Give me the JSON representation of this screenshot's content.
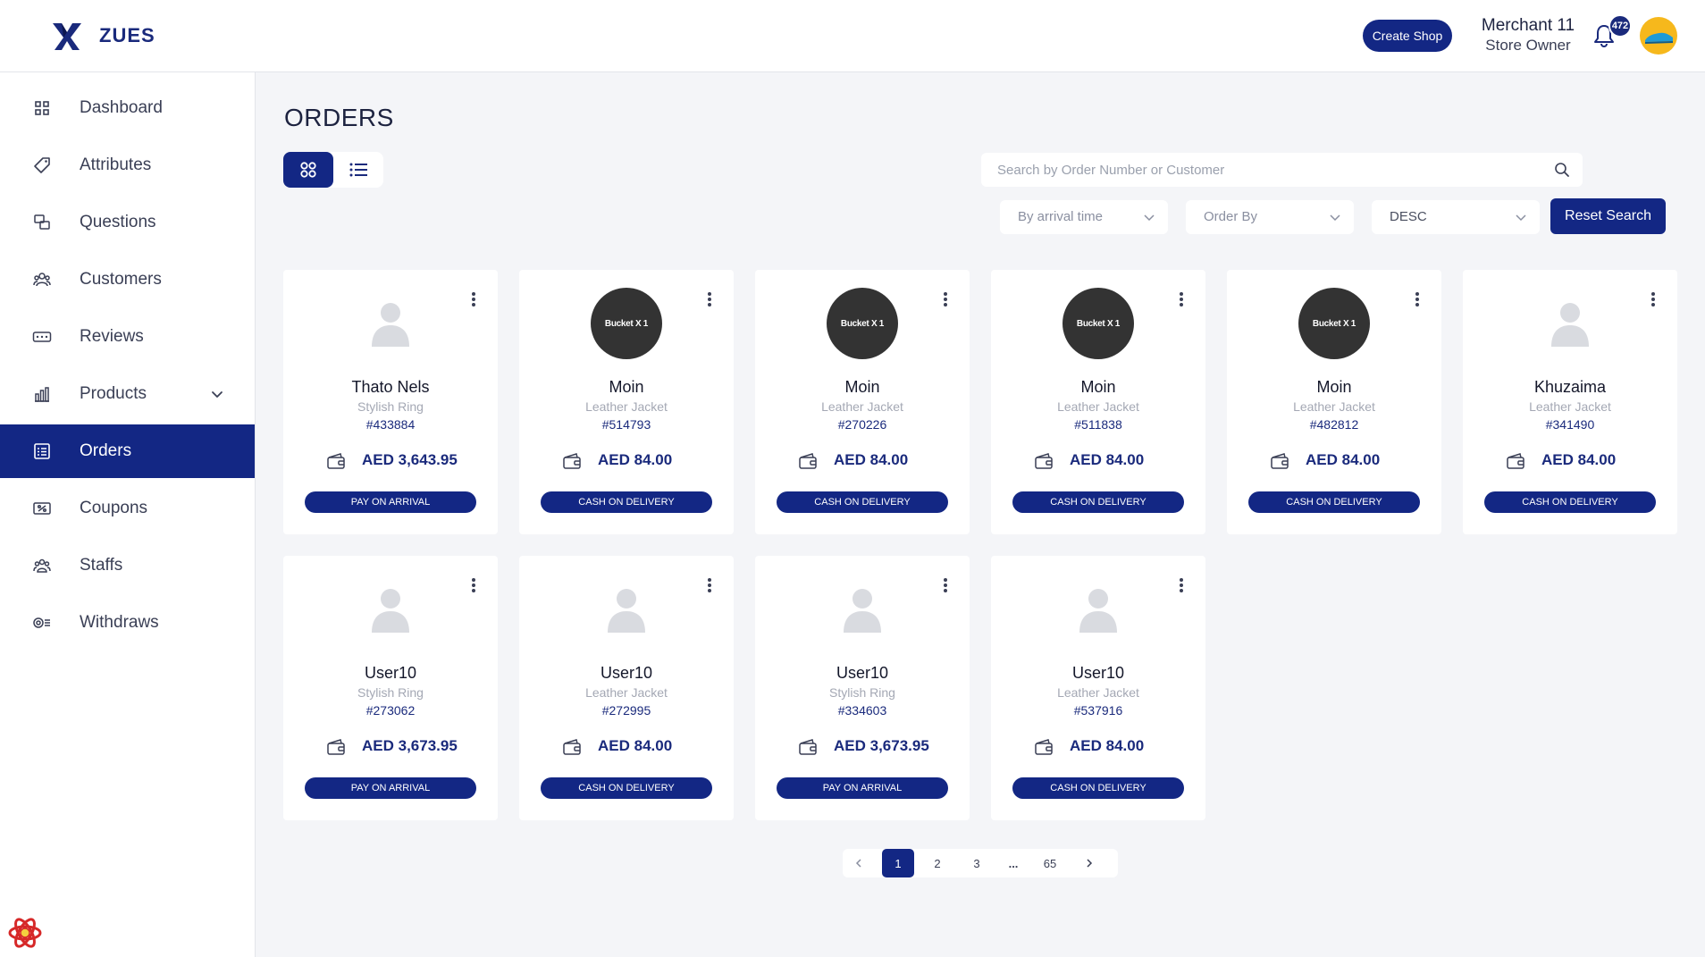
{
  "app": {
    "name": "ZUES"
  },
  "header": {
    "create_shop": "Create Shop",
    "user_name": "Merchant 11",
    "user_role": "Store Owner",
    "notification_count": "472"
  },
  "sidebar": {
    "items": [
      {
        "label": "Dashboard",
        "icon": "dashboard-icon"
      },
      {
        "label": "Attributes",
        "icon": "tag-icon"
      },
      {
        "label": "Questions",
        "icon": "questions-icon"
      },
      {
        "label": "Customers",
        "icon": "customers-icon"
      },
      {
        "label": "Reviews",
        "icon": "reviews-icon"
      },
      {
        "label": "Products",
        "icon": "products-icon"
      },
      {
        "label": "Orders",
        "icon": "orders-icon"
      },
      {
        "label": "Coupons",
        "icon": "coupons-icon"
      },
      {
        "label": "Staffs",
        "icon": "staffs-icon"
      },
      {
        "label": "Withdraws",
        "icon": "withdraws-icon"
      }
    ],
    "active": "Orders"
  },
  "main": {
    "title": "ORDERS",
    "search_placeholder": "Search by Order Number or Customer",
    "filter_sort_by": "By arrival time",
    "filter_order_by": "Order By",
    "filter_direction": "DESC",
    "reset_label": "Reset Search"
  },
  "orders": [
    {
      "name": "Thato Nels",
      "product": "Stylish Ring",
      "order_no": "#433884",
      "amount": "AED 3,643.95",
      "payment": "PAY ON ARRIVAL",
      "image": "placeholder",
      "image_text": ""
    },
    {
      "name": "Moin",
      "product": "Leather Jacket",
      "order_no": "#514793",
      "amount": "AED 84.00",
      "payment": "CASH ON DELIVERY",
      "image": "product",
      "image_text": "Bucket X 1"
    },
    {
      "name": "Moin",
      "product": "Leather Jacket",
      "order_no": "#270226",
      "amount": "AED 84.00",
      "payment": "CASH ON DELIVERY",
      "image": "product",
      "image_text": "Bucket X 1"
    },
    {
      "name": "Moin",
      "product": "Leather Jacket",
      "order_no": "#511838",
      "amount": "AED 84.00",
      "payment": "CASH ON DELIVERY",
      "image": "product",
      "image_text": "Bucket X 1"
    },
    {
      "name": "Moin",
      "product": "Leather Jacket",
      "order_no": "#482812",
      "amount": "AED 84.00",
      "payment": "CASH ON DELIVERY",
      "image": "product",
      "image_text": "Bucket X 1"
    },
    {
      "name": "Khuzaima",
      "product": "Leather Jacket",
      "order_no": "#341490",
      "amount": "AED 84.00",
      "payment": "CASH ON DELIVERY",
      "image": "placeholder",
      "image_text": ""
    },
    {
      "name": "User10",
      "product": "Stylish Ring",
      "order_no": "#273062",
      "amount": "AED 3,673.95",
      "payment": "PAY ON ARRIVAL",
      "image": "placeholder",
      "image_text": ""
    },
    {
      "name": "User10",
      "product": "Leather Jacket",
      "order_no": "#272995",
      "amount": "AED 84.00",
      "payment": "CASH ON DELIVERY",
      "image": "placeholder",
      "image_text": ""
    },
    {
      "name": "User10",
      "product": "Stylish Ring",
      "order_no": "#334603",
      "amount": "AED 3,673.95",
      "payment": "PAY ON ARRIVAL",
      "image": "placeholder",
      "image_text": ""
    },
    {
      "name": "User10",
      "product": "Leather Jacket",
      "order_no": "#537916",
      "amount": "AED 84.00",
      "payment": "CASH ON DELIVERY",
      "image": "placeholder",
      "image_text": ""
    }
  ],
  "pagination": {
    "pages": [
      "1",
      "2",
      "3",
      "...",
      "65"
    ],
    "current": "1"
  },
  "colors": {
    "primary": "#132784",
    "accent_text": "#1a2a7c",
    "background": "#f4f5f8"
  }
}
